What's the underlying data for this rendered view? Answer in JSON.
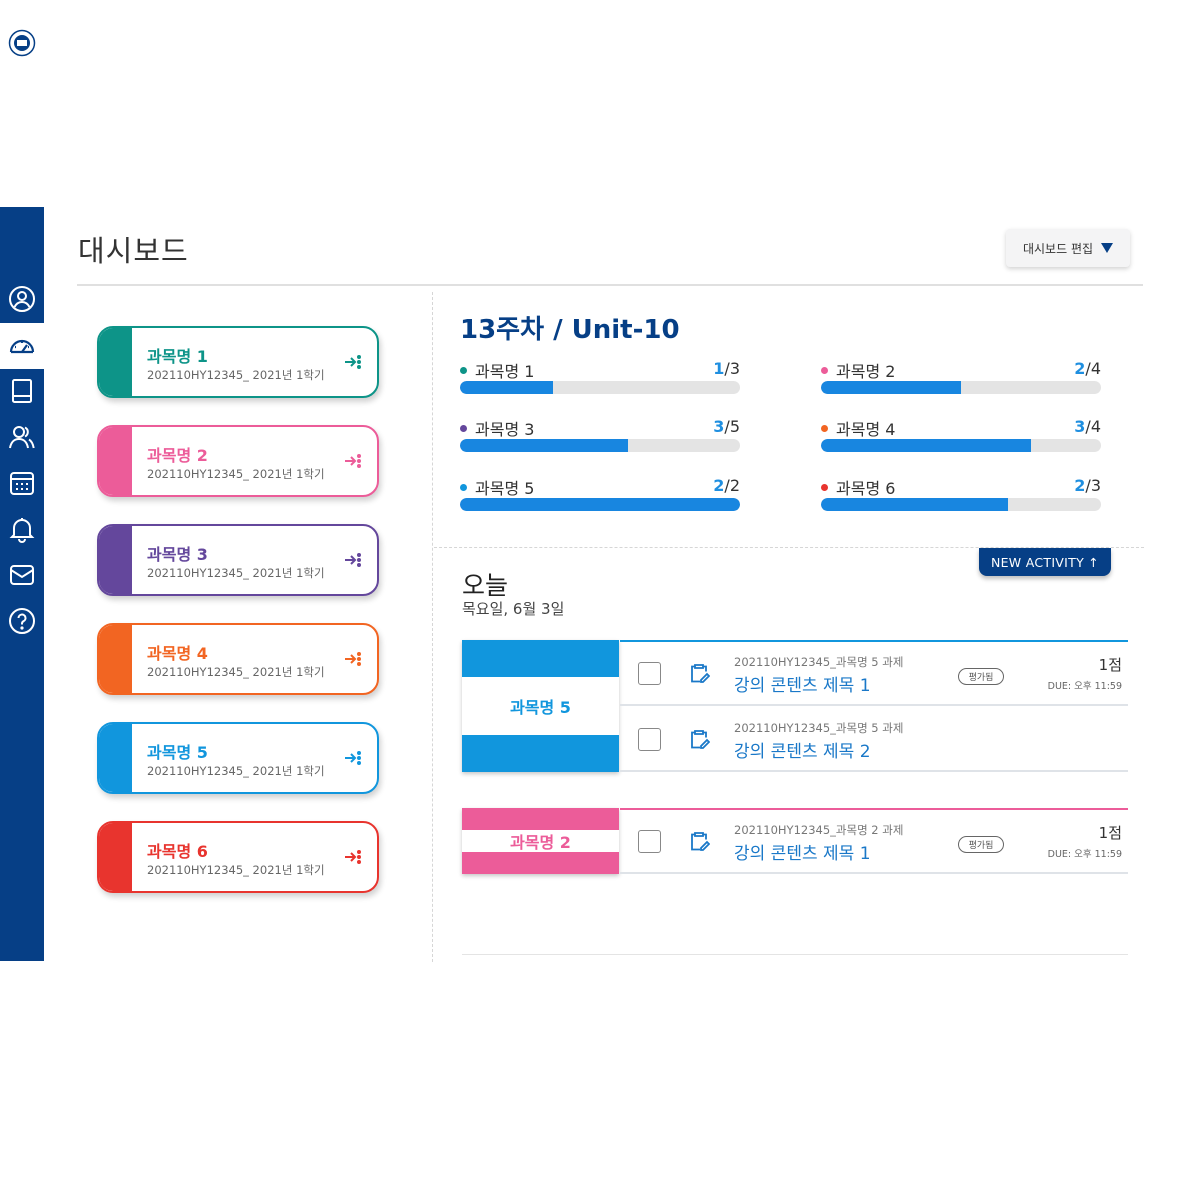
{
  "header": {
    "title": "대시보드",
    "edit_label": "대시보드 편집"
  },
  "sidebar": {
    "items": [
      {
        "icon": "university-logo-icon"
      },
      {
        "icon": "profile-icon"
      },
      {
        "icon": "dashboard-icon",
        "active": true
      },
      {
        "icon": "book-icon"
      },
      {
        "icon": "users-icon"
      },
      {
        "icon": "calendar-icon"
      },
      {
        "icon": "bell-icon"
      },
      {
        "icon": "mail-icon"
      },
      {
        "icon": "help-icon"
      }
    ]
  },
  "courses": [
    {
      "name": "과목명 1",
      "code": "202110HY12345_ 2021년 1학기",
      "color": "#0d9488"
    },
    {
      "name": "과목명 2",
      "code": "202110HY12345_ 2021년 1학기",
      "color": "#ec5c99"
    },
    {
      "name": "과목명 3",
      "code": "202110HY12345_ 2021년 1학기",
      "color": "#64479c"
    },
    {
      "name": "과목명 4",
      "code": "202110HY12345_ 2021년 1학기",
      "color": "#f26522"
    },
    {
      "name": "과목명 5",
      "code": "202110HY12345_ 2021년 1학기",
      "color": "#1196dd"
    },
    {
      "name": "과목명 6",
      "code": "202110HY12345_ 2021년 1학기",
      "color": "#e8342e"
    }
  ],
  "week": {
    "title": "13주차 / Unit-10",
    "progress": [
      {
        "name": "과목명 1",
        "done": "1",
        "total": "/3",
        "ratio": 0.333,
        "dot": "#0d9488"
      },
      {
        "name": "과목명 2",
        "done": "2",
        "total": "/4",
        "ratio": 0.5,
        "dot": "#ec5c99"
      },
      {
        "name": "과목명 3",
        "done": "3",
        "total": "/5",
        "ratio": 0.6,
        "dot": "#64479c"
      },
      {
        "name": "과목명 4",
        "done": "3",
        "total": "/4",
        "ratio": 0.75,
        "dot": "#f26522"
      },
      {
        "name": "과목명 5",
        "done": "2",
        "total": "/2",
        "ratio": 1.0,
        "dot": "#1196dd"
      },
      {
        "name": "과목명 6",
        "done": "2",
        "total": "/3",
        "ratio": 0.667,
        "dot": "#e8342e"
      }
    ]
  },
  "today": {
    "new_activity": "NEW ACTIVITY ↑",
    "title": "오늘",
    "date": "목요일, 6월 3일",
    "groups": [
      {
        "course": "과목명 5",
        "color": "#1196dd",
        "tasks": [
          {
            "subtitle": "202110HY12345_과목명 5 과제",
            "title": "강의 콘텐츠 제목 1",
            "badge": "평가됨",
            "score": "1점",
            "due": "DUE: 오후 11:59"
          },
          {
            "subtitle": "202110HY12345_과목명 5 과제",
            "title": "강의 콘텐츠 제목 2",
            "badge": "",
            "score": "",
            "due": ""
          }
        ]
      },
      {
        "course": "과목명 2",
        "color": "#ec5c99",
        "tasks": [
          {
            "subtitle": "202110HY12345_과목명 2 과제",
            "title": "강의 콘텐츠 제목 1",
            "badge": "평가됨",
            "score": "1점",
            "due": "DUE: 오후 11:59"
          }
        ]
      }
    ]
  }
}
